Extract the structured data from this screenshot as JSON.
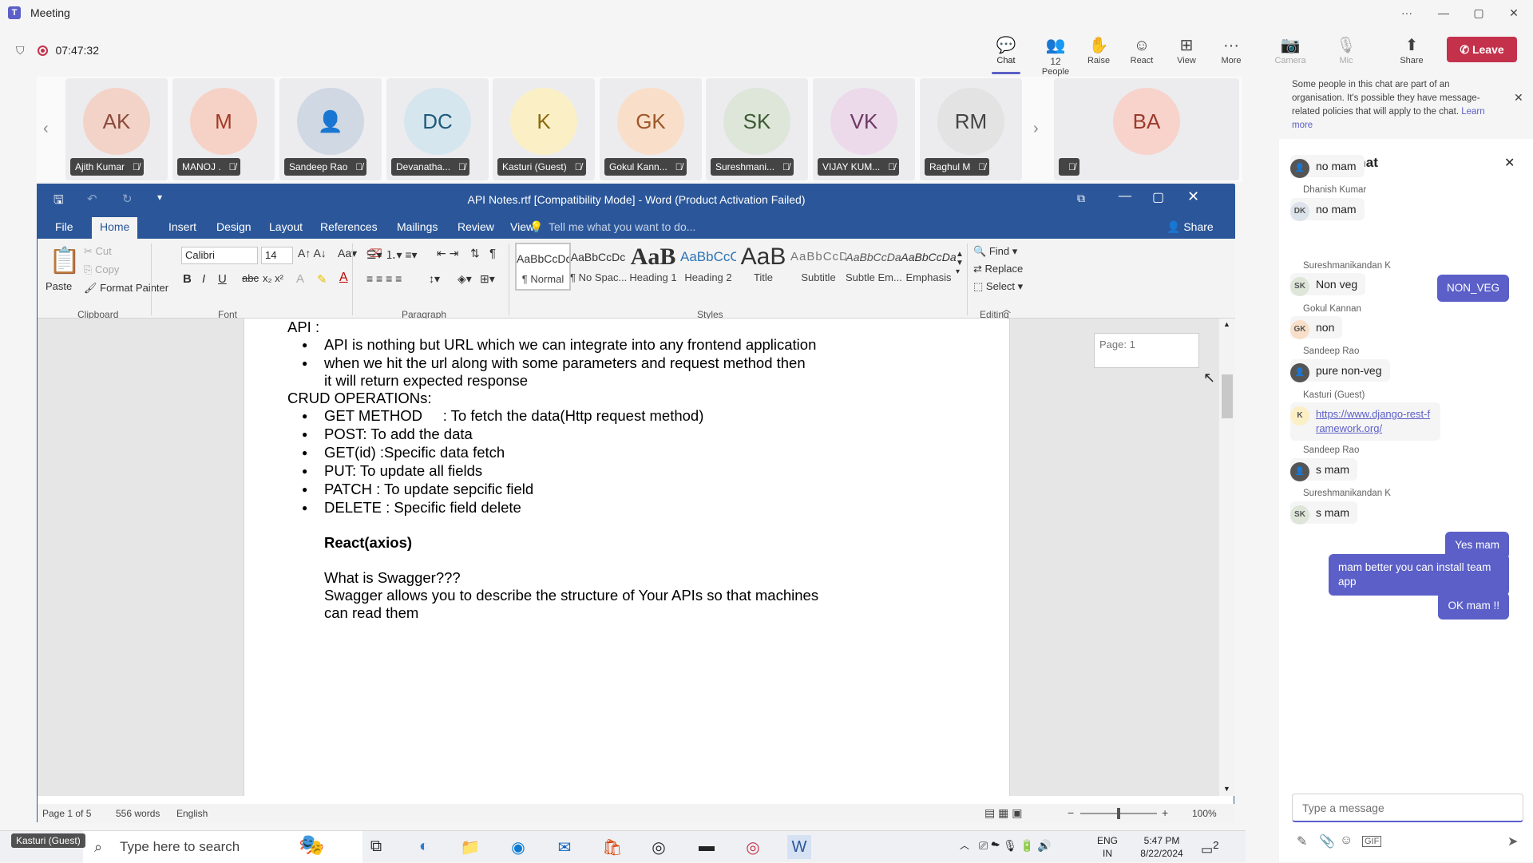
{
  "app": {
    "title": "Meeting",
    "timer": "07:47:32"
  },
  "window_controls": {
    "more": "···",
    "minimize": "—",
    "restore": "▢",
    "close": "✕"
  },
  "meeting_tools": [
    {
      "label": "Chat",
      "icon": "chat-icon",
      "glyph": "💬",
      "active": true
    },
    {
      "label": "People",
      "icon": "people-icon",
      "glyph": "👥",
      "count": "12"
    },
    {
      "label": "Raise",
      "icon": "raise-hand-icon",
      "glyph": "✋"
    },
    {
      "label": "React",
      "icon": "react-icon",
      "glyph": "☺"
    },
    {
      "label": "View",
      "icon": "view-icon",
      "glyph": "⊞"
    },
    {
      "label": "More",
      "icon": "more-icon",
      "glyph": "···"
    },
    {
      "label": "Camera",
      "icon": "camera-off-icon",
      "glyph": "📷",
      "disabled": true
    },
    {
      "label": "Mic",
      "icon": "mic-off-icon",
      "glyph": "🎙",
      "disabled": true
    },
    {
      "label": "Share",
      "icon": "share-icon",
      "glyph": "⬆"
    }
  ],
  "leave_label": "Leave",
  "participants": [
    {
      "initials": "AK",
      "name": "Ajith Kumar",
      "color": "#f3d3c8",
      "fg": "#8a4a3c"
    },
    {
      "initials": "M",
      "name": "MANOJ .",
      "color": "#f6d2c6",
      "fg": "#a33a24"
    },
    {
      "initials": "",
      "name": "Sandeep Rao",
      "color": "#cfd8e3",
      "fg": "#333"
    },
    {
      "initials": "DC",
      "name": "Devanatha...",
      "color": "#d5e6ef",
      "fg": "#1f5a7a"
    },
    {
      "initials": "K",
      "name": "Kasturi (Guest)",
      "color": "#fbefc6",
      "fg": "#8a6a10"
    },
    {
      "initials": "GK",
      "name": "Gokul Kann...",
      "color": "#f9dfc9",
      "fg": "#a0562a"
    },
    {
      "initials": "SK",
      "name": "Sureshmani...",
      "color": "#dde6d9",
      "fg": "#3d5a33"
    },
    {
      "initials": "VK",
      "name": "VIJAY KUM...",
      "color": "#ecd9ea",
      "fg": "#6d3a66"
    },
    {
      "initials": "RM",
      "name": "Raghul M",
      "color": "#e3e3e3",
      "fg": "#444"
    },
    {
      "initials": "BA",
      "name": "",
      "color": "#f7d3cc",
      "fg": "#9b3b2c"
    }
  ],
  "word": {
    "title": "API Notes.rtf [Compatibility Mode] - Word (Product Activation Failed)",
    "tabs": [
      "File",
      "Home",
      "Insert",
      "Design",
      "Layout",
      "References",
      "Mailings",
      "Review",
      "View"
    ],
    "tell_me": "Tell me what you want to do...",
    "share": "Share",
    "clipboard": {
      "paste": "Paste",
      "cut": "Cut",
      "copy": "Copy",
      "format_painter": "Format Painter",
      "group": "Clipboard"
    },
    "font": {
      "name": "Calibri",
      "size": "14",
      "group": "Font"
    },
    "paragraph_group": "Paragraph",
    "styles": [
      {
        "preview": "AaBbCcDc",
        "name": "¶ Normal"
      },
      {
        "preview": "AaBbCcDc",
        "name": "¶ No Spac..."
      },
      {
        "preview": "AaB",
        "name": "Heading 1"
      },
      {
        "preview": "AaBbCcC",
        "name": "Heading 2"
      },
      {
        "preview": "AaB",
        "name": "Title"
      },
      {
        "preview": "AaBbCcD",
        "name": "Subtitle"
      },
      {
        "preview": "AaBbCcDa",
        "name": "Subtle Em..."
      },
      {
        "preview": "AaBbCcDa",
        "name": "Emphasis"
      }
    ],
    "styles_group": "Styles",
    "editing": {
      "find": "Find",
      "replace": "Replace",
      "select": "Select",
      "group": "Editing"
    },
    "page_box": "Page: 1",
    "doc": {
      "api_heading": "API :",
      "api_b1": "API is nothing but URL which we can integrate into any frontend application",
      "api_b2a": "when we hit the url along with some parameters and request method then",
      "api_b2b": "it will return expected response",
      "crud_heading": "CRUD OPERATIONs:",
      "crud": [
        "GET METHOD     : To fetch the data(Http request method)",
        "POST: To add the data",
        "GET(id) :Specific data fetch",
        "PUT: To update all fields",
        "PATCH : To update sepcific field",
        "DELETE : Specific field delete"
      ],
      "react": "React(axios)",
      "swagger_q": "What is Swagger???",
      "swagger_a1": "Swagger allows you to describe the structure of Your APIs so that machines",
      "swagger_a2": "can read them"
    },
    "status": {
      "page": "Page 1 of 5",
      "words": "556 words",
      "lang": "English",
      "zoom": "100%"
    }
  },
  "chat": {
    "notice": "Some people in this chat are part of an organisation. It's possible they have message-related policies that will apply to the chat.",
    "learn_more": "Learn more",
    "header": "Meeting chat",
    "messages": [
      {
        "sender": "",
        "text": "no mam",
        "av": "",
        "avbg": "#555"
      },
      {
        "sender": "Dhanish Kumar",
        "text": "no mam",
        "av": "DK",
        "avbg": "#dde3ea"
      },
      {
        "sender": "Sureshmanikandan K",
        "text": "Non veg",
        "av": "SK",
        "avbg": "#dde6d9"
      },
      {
        "sender": "Gokul Kannan",
        "text": "non",
        "av": "GK",
        "avbg": "#f9dfc9"
      },
      {
        "sender": "Sandeep Rao",
        "text": "pure non-veg",
        "av": "",
        "avbg": "#555"
      },
      {
        "sender": "Kasturi (Guest)",
        "text": "https://www.django-rest-framework.org/",
        "av": "K",
        "avbg": "#fbefc6"
      },
      {
        "sender": "Sandeep Rao",
        "text": "s mam",
        "av": "",
        "avbg": "#555"
      },
      {
        "sender": "Sureshmanikandan K",
        "text": "s mam",
        "av": "SK",
        "avbg": "#dde6d9"
      }
    ],
    "mine": [
      "NON_VEG",
      "Yes mam",
      "mam better you can install team app",
      "OK mam !!"
    ],
    "input_placeholder": "Type a message"
  },
  "taskbar": {
    "search_placeholder": "Type here to search",
    "lang1": "ENG",
    "lang2": "IN",
    "time": "5:47 PM",
    "date": "8/22/2024",
    "notif_count": "2",
    "self_name": "Kasturi (Guest)"
  }
}
